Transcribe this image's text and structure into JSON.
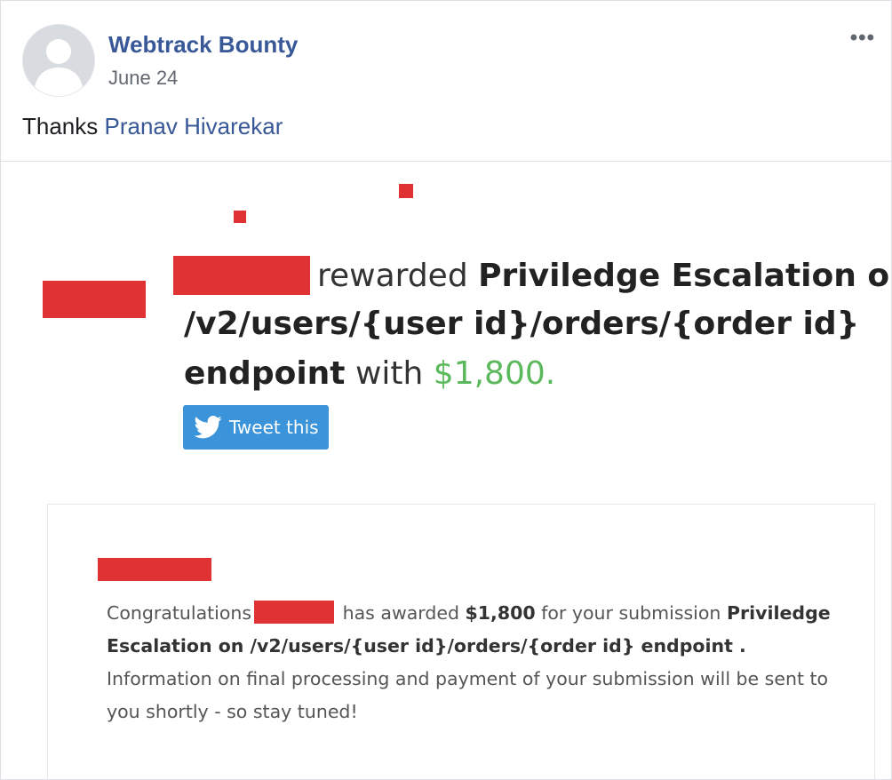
{
  "post": {
    "author": "Webtrack Bounty",
    "date": "June 24",
    "more_label": "•••",
    "message_prefix": "Thanks",
    "mention": "Pranav Hivarekar"
  },
  "image": {
    "rewarded": "rewarded",
    "title_line1": "Priviledge Escalation on",
    "title_line2": "/v2/users/{user id}/orders/{order id}",
    "title_line3": "endpoint",
    "with": "with",
    "amount": "$1,800.",
    "tweet_label": "Tweet this",
    "card": {
      "congrats": "Congratulations",
      "has_awarded": "has awarded",
      "amount": "$1,800",
      "for_submission": "for your submission",
      "submission_title": "Priviledge Escalation on /v2/users/{user id}/orders/{order id} endpoint .",
      "info": "Information on final processing and payment of your submission will be sent to you shortly - so stay tuned!"
    }
  },
  "colors": {
    "link": "#385898",
    "redaction": "#e03233",
    "amount_green": "#5cb85c",
    "twitter_blue": "#3b94d9"
  },
  "icons": [
    "default-avatar-icon",
    "more-options-icon",
    "twitter-bird-icon"
  ]
}
